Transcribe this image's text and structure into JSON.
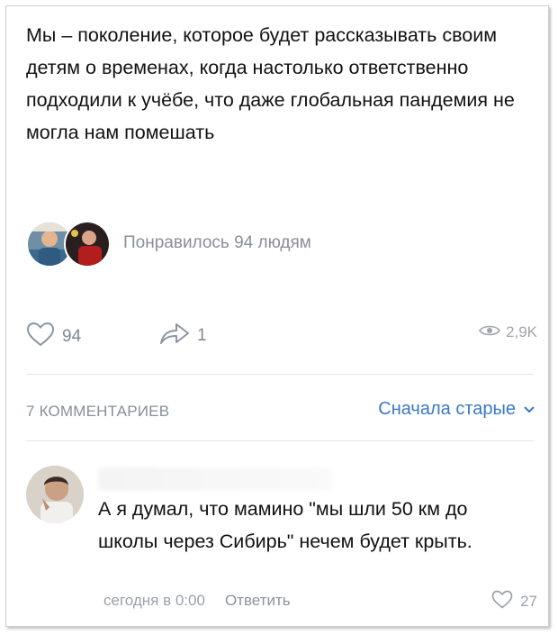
{
  "post": {
    "text": "Мы – поколение, которое будет рассказывать своим детям о временах, когда настолько ответственно подходили к учёбе, что даже глобальная пандемия не могла нам помешать",
    "liked_by_text": "Понравилось 94 людям",
    "likes": "94",
    "shares": "1",
    "views": "2,9K"
  },
  "comments_header": {
    "count_label": "7 КОММЕНТАРИЕВ",
    "sort_label": "Сначала старые"
  },
  "comment": {
    "text": "А я думал, что мамино \"мы шли 50 км до школы через Сибирь\" нечем будет крыть.",
    "time": "сегодня в 0:00",
    "reply_label": "Ответить",
    "likes": "27"
  },
  "colors": {
    "link": "#3a78c3",
    "muted": "#888f99",
    "text": "#111111"
  },
  "icons": {
    "like": "heart-icon",
    "share": "share-icon",
    "views": "eye-icon",
    "sort": "chevron-down-icon"
  }
}
